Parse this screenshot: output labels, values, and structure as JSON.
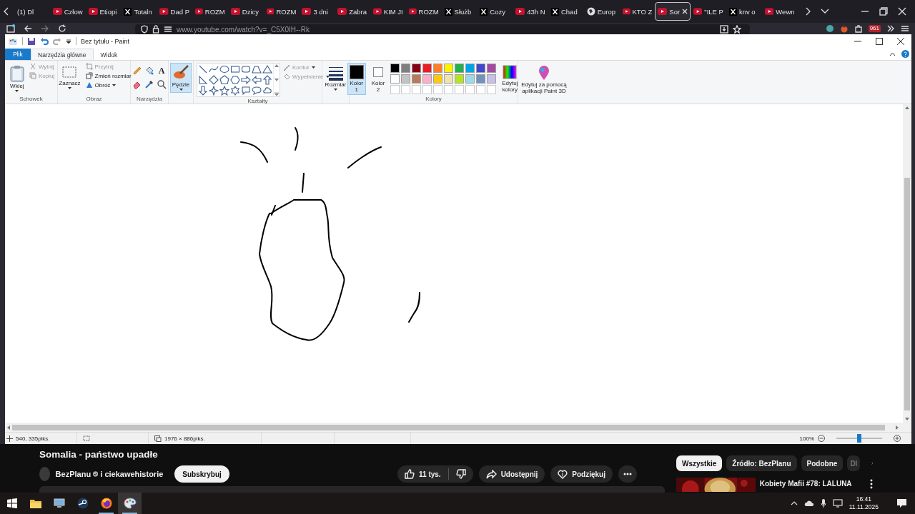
{
  "browser": {
    "tabs": [
      {
        "label": "(1) Dl",
        "selected": false
      },
      {
        "label": "Człow",
        "kind": "youtube",
        "selected": false
      },
      {
        "label": "Etiopi",
        "kind": "youtube",
        "selected": false
      },
      {
        "label": "Totaln",
        "kind": "x",
        "selected": false
      },
      {
        "label": "Dad P",
        "kind": "youtube",
        "selected": false
      },
      {
        "label": "ROZM",
        "kind": "youtube",
        "selected": false
      },
      {
        "label": "Dzicy",
        "kind": "youtube",
        "selected": false
      },
      {
        "label": "ROZM",
        "kind": "youtube",
        "selected": false
      },
      {
        "label": "3 dni",
        "kind": "youtube",
        "selected": false
      },
      {
        "label": "Zabra",
        "kind": "youtube",
        "selected": false
      },
      {
        "label": "KIM JI",
        "kind": "youtube",
        "selected": false
      },
      {
        "label": "ROZM",
        "kind": "youtube",
        "selected": false
      },
      {
        "label": "Służb",
        "kind": "x",
        "selected": false
      },
      {
        "label": "Cozy",
        "kind": "x",
        "selected": false
      },
      {
        "label": "43h N",
        "kind": "youtube",
        "selected": false
      },
      {
        "label": "Chad",
        "kind": "x",
        "selected": false
      },
      {
        "label": "Europ",
        "kind": "globe",
        "selected": false
      },
      {
        "label": "KTO Z",
        "kind": "youtube",
        "selected": false
      },
      {
        "label": "Sor",
        "kind": "youtube",
        "selected": true
      },
      {
        "label": "\"ILE P",
        "kind": "youtube",
        "selected": false
      },
      {
        "label": "knv o",
        "kind": "x",
        "selected": false
      },
      {
        "label": "Wewn",
        "kind": "youtube",
        "selected": false
      }
    ],
    "url": "www.youtube.com/watch?v=_C5X0IH--Rk",
    "badge": "961"
  },
  "paint": {
    "title": "Bez tytułu - Paint",
    "file_menu": "Plik",
    "ribbon_tabs": [
      {
        "label": "Narzędzia główne",
        "selected": true
      },
      {
        "label": "Widok",
        "selected": false
      }
    ],
    "clipboard": {
      "label": "Schowek",
      "paste": "Wklej",
      "cut": {
        "label": "Wytnij",
        "disabled": true
      },
      "copy": {
        "label": "Kopiuj",
        "disabled": true
      }
    },
    "image": {
      "label": "Obraz",
      "select": "Zaznacz",
      "crop": {
        "label": "Przytnij",
        "disabled": true
      },
      "resize": "Zmień rozmiar",
      "rotate": "Obróć"
    },
    "tools": {
      "label": "Narzędzia",
      "text_tool": "A"
    },
    "brushes": {
      "label": "Pędzle",
      "selected": true
    },
    "shapes": {
      "label": "Kształty",
      "outline": {
        "label": "Kontur",
        "disabled": true
      },
      "fill": {
        "label": "Wypełnienie",
        "disabled": true
      }
    },
    "size": {
      "label": "Rozmiar"
    },
    "colors": {
      "label": "Kolory",
      "color1": {
        "label": "Kolor 1",
        "color": "#000000",
        "selected": true
      },
      "color2": {
        "label": "Kolor 2",
        "color": "#ffffff",
        "selected": false
      },
      "palette": [
        {
          "color": "#000000"
        },
        {
          "color": "#7f7f7f"
        },
        {
          "color": "#880015"
        },
        {
          "color": "#ed1c24"
        },
        {
          "color": "#ff7f27"
        },
        {
          "color": "#fff200"
        },
        {
          "color": "#22b14c"
        },
        {
          "color": "#00a2e8"
        },
        {
          "color": "#3f48cc"
        },
        {
          "color": "#a349a4"
        },
        {
          "color": "#ffffff"
        },
        {
          "color": "#c3c3c3"
        },
        {
          "color": "#b97a57"
        },
        {
          "color": "#ffaec9"
        },
        {
          "color": "#ffc90e"
        },
        {
          "color": "#efe4b0"
        },
        {
          "color": "#b5e61d"
        },
        {
          "color": "#99d9ea"
        },
        {
          "color": "#7092be"
        },
        {
          "color": "#c8bfe7"
        }
      ],
      "edit": "Edytuj kolory"
    },
    "paint3d": "Edytuj za pomocą aplikacji Paint 3D",
    "status": {
      "cursor": "540, 335piks.",
      "canvas_size": "1976 × 886piks.",
      "zoom": "100%",
      "zoom_slider": {
        "level": 0.5
      }
    }
  },
  "youtube": {
    "title": "Somalia - państwo upadłe",
    "channel": "BezPlanu",
    "collaborator": "i ciekawehistorie",
    "subscribe": "Subskrybuj",
    "likes": "11 tys.",
    "share": "Udostępnij",
    "thanks": "Podziękuj",
    "chips": [
      {
        "label": "Wszystkie",
        "selected": true
      },
      {
        "label": "Źródło: BezPlanu",
        "selected": false
      },
      {
        "label": "Podobne",
        "selected": false
      },
      {
        "label": "Dl",
        "selected": false
      }
    ],
    "video": {
      "title": "Kobiety Mafii #78: LALUNA"
    }
  },
  "taskbar": {
    "apps": [
      {
        "kind": "start",
        "running": false,
        "active": false
      },
      {
        "kind": "explorer",
        "running": false,
        "active": false
      },
      {
        "kind": "remote-desktop",
        "running": false,
        "active": false
      },
      {
        "kind": "steam",
        "running": false,
        "active": false
      },
      {
        "kind": "firefox",
        "running": true,
        "active": false
      },
      {
        "kind": "paint",
        "running": true,
        "active": true
      }
    ],
    "time": "16:41",
    "date": "11.11.2025"
  }
}
